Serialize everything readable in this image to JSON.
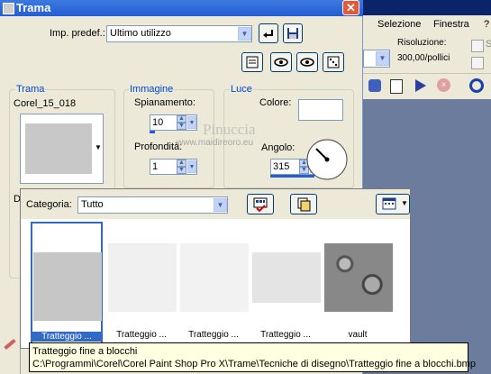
{
  "dialog": {
    "title": "Trama",
    "preset_label": "Imp. predef.:",
    "preset_value": "Ultimo utilizzo",
    "trama": {
      "group_title": "Trama",
      "texture_name": "Corel_15_018",
      "d_label": "D"
    },
    "immagine": {
      "group_title": "Immagine",
      "spianamento_label": "Spianamento:",
      "spianamento_value": "10",
      "profondita_label": "Profondità:",
      "profondita_value": "1"
    },
    "luce": {
      "group_title": "Luce",
      "colore_label": "Colore:",
      "angolo_label": "Angolo:",
      "angolo_value": "315"
    },
    "watermark": {
      "line1": "Pinuccia",
      "line2": "www.maidireoro.eu"
    }
  },
  "popup": {
    "categoria_label": "Categoria:",
    "categoria_value": "Tutto",
    "thumbnails": [
      {
        "label": "Tratteggio ..."
      },
      {
        "label": "Tratteggio ..."
      },
      {
        "label": "Tratteggio ..."
      },
      {
        "label": "Tratteggio ..."
      },
      {
        "label": "vault"
      }
    ]
  },
  "tooltip": {
    "line1": "Tratteggio fine a blocchi",
    "line2": "C:\\Programmi\\Corel\\Corel Paint Shop Pro X\\Trame\\Tecniche di disegno\\Tratteggio fine a blocchi.bmp"
  },
  "background_app": {
    "menu": [
      "Selezione",
      "Finestra",
      "?"
    ],
    "risoluzione_label": "Risoluzione:",
    "risoluzione_value": "300,00/pollici",
    "partial_checkbox": "S"
  },
  "colors": {
    "title_bar": "#245ed6",
    "group_title": "#0046d5",
    "dialog_bg": "#ece9d8",
    "close_button": "#e25a3a"
  }
}
